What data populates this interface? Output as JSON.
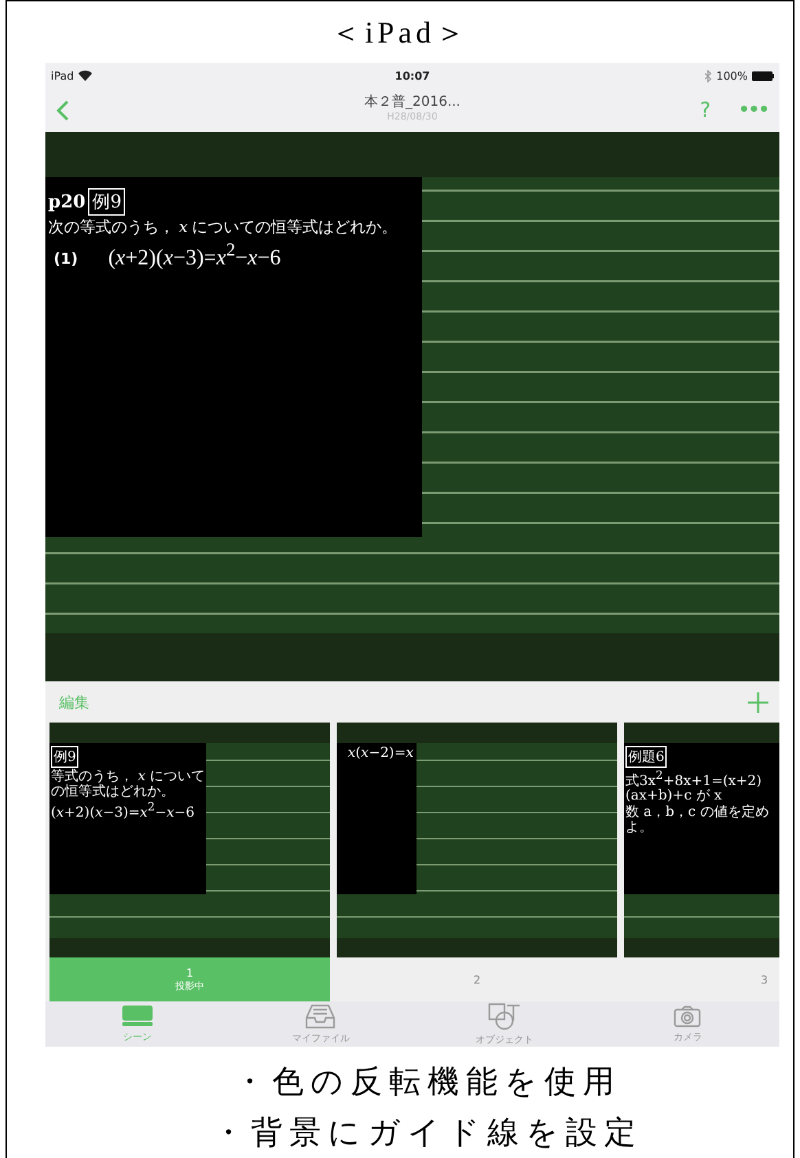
{
  "caption_top": "＜iPad＞",
  "status_bar": {
    "device": "iPad",
    "time": "10:07",
    "battery": "100%"
  },
  "nav": {
    "title": "本２普_2016...",
    "subtitle": "H28/08/30",
    "help": "?",
    "more": "•••"
  },
  "board": {
    "page": "p20",
    "example": "例9",
    "question": "次の等式のうち， *x* についての恒等式はどれか。",
    "item_number": "(1)",
    "formula": "(*x*+2)(*x*−3)=*x*$^{2}$−*x*−6"
  },
  "edit_bar": {
    "edit": "編集"
  },
  "scenes": [
    {
      "number": "1",
      "status": "投影中",
      "selected": true,
      "label": "例9",
      "lines": [
        "等式のうち， *x* についての恒等式はどれか。",
        "(*x*+2)(*x*−3)=*x*$^{2}$−*x*−6"
      ]
    },
    {
      "number": "2",
      "selected": false,
      "lines": [
        "*x*(*x*−2)=*x*"
      ]
    },
    {
      "number": "3",
      "selected": false,
      "label": "例題6",
      "lines": [
        "式3x$^{2}$+8x+1=(x+2)(ax+b)+c が x",
        "数 a，b，c の値を定めよ。"
      ]
    }
  ],
  "tabs": [
    {
      "label": "シーン",
      "kind": "scene",
      "selected": true
    },
    {
      "label": "マイファイル",
      "kind": "files",
      "selected": false
    },
    {
      "label": "オブジェクト",
      "kind": "object",
      "selected": false
    },
    {
      "label": "カメラ",
      "kind": "camera",
      "selected": false
    }
  ],
  "captions": [
    "・色の反転機能を使用",
    "・背景にガイド線を設定"
  ]
}
